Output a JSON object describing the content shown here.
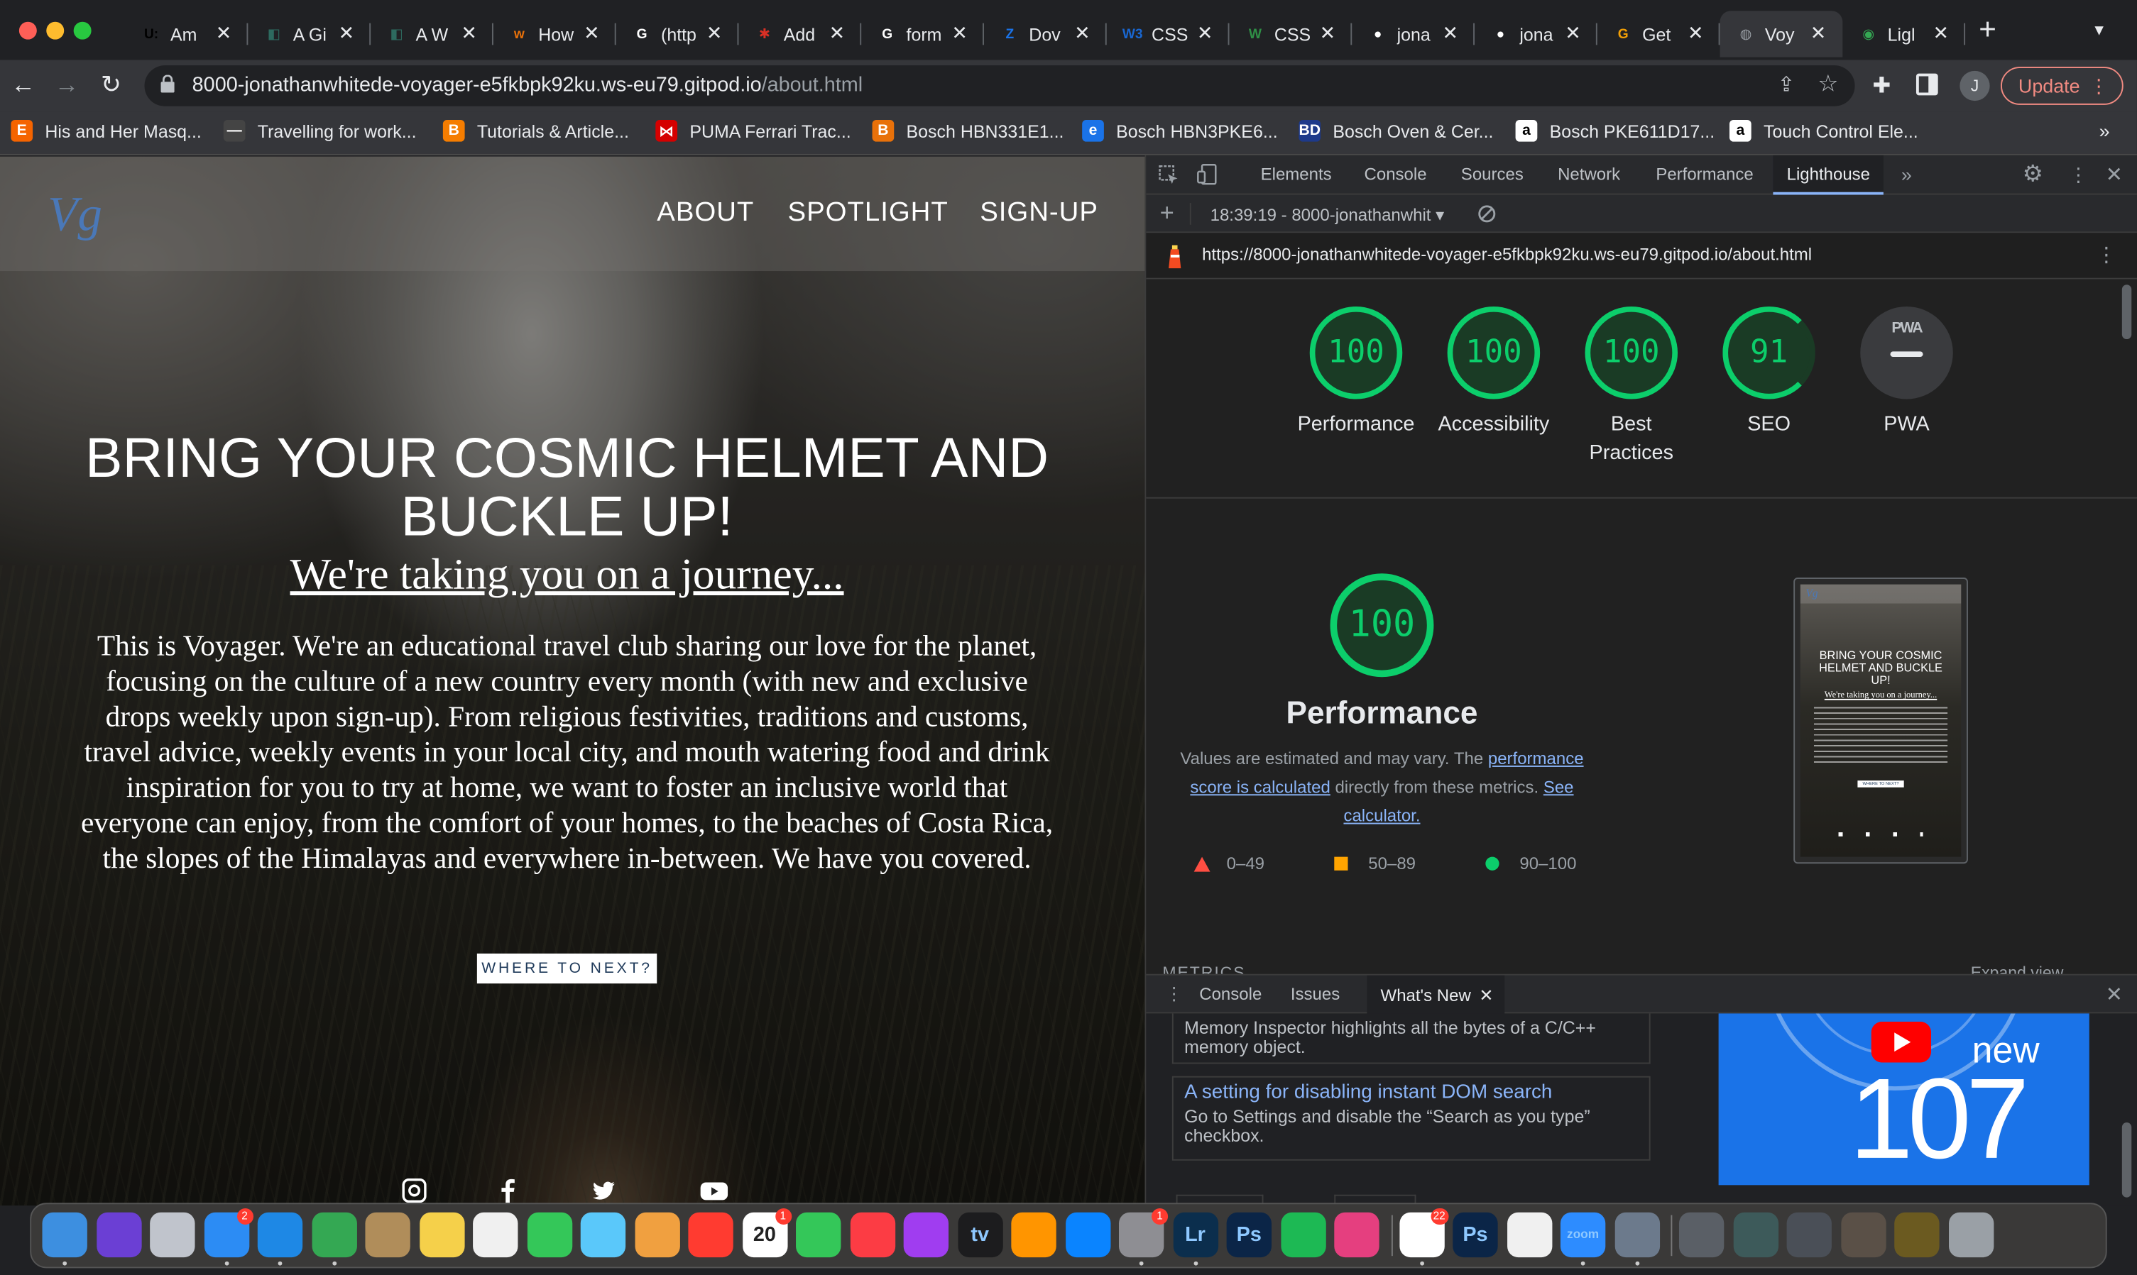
{
  "browser": {
    "tabs": [
      {
        "title": "Am",
        "icon": "upwork-icon",
        "favicon_color": "#000000",
        "favicon_text": "U:"
      },
      {
        "title": "A Gi",
        "icon": "gitpod-icon",
        "favicon_color": "#2d6a5f",
        "favicon_text": "◧"
      },
      {
        "title": "A W",
        "icon": "gitpod-icon",
        "favicon_color": "#2d6a5f",
        "favicon_text": "◧"
      },
      {
        "title": "How",
        "icon": "w3-icon",
        "favicon_color": "#e8710a",
        "favicon_text": "w"
      },
      {
        "title": "(http",
        "icon": "google-icon",
        "favicon_color": "#ffffff",
        "favicon_text": "G"
      },
      {
        "title": "Add",
        "icon": "asterisk-icon",
        "favicon_color": "#d93025",
        "favicon_text": "✱"
      },
      {
        "title": "form",
        "icon": "google-icon",
        "favicon_color": "#ffffff",
        "favicon_text": "G"
      },
      {
        "title": "Dov",
        "icon": "zoom-icon",
        "favicon_color": "#1a73e8",
        "favicon_text": "Z"
      },
      {
        "title": "CSS",
        "icon": "w3schools-icon",
        "favicon_color": "#1967d2",
        "favicon_text": "W3"
      },
      {
        "title": "CSS",
        "icon": "w3schools-green-icon",
        "favicon_color": "#2f8f46",
        "favicon_text": "W"
      },
      {
        "title": "jona",
        "icon": "github-icon",
        "favicon_color": "#ffffff",
        "favicon_text": "●"
      },
      {
        "title": "jona",
        "icon": "github-icon",
        "favicon_color": "#ffffff",
        "favicon_text": "●"
      },
      {
        "title": "Get",
        "icon": "gitpod-orange-icon",
        "favicon_color": "#f29f05",
        "favicon_text": "G"
      },
      {
        "title": "Voy",
        "icon": "globe-icon",
        "favicon_color": "#9aa0a6",
        "favicon_text": "◍",
        "active": true
      },
      {
        "title": "Ligl",
        "icon": "chrome-icon",
        "favicon_color": "#34a853",
        "favicon_text": "◉"
      }
    ],
    "address": {
      "host": "8000-jonathanwhitede-voyager-e5fkbpk92ku.ws-eu79.gitpod.io",
      "path": "/about.html"
    },
    "update_label": "Update",
    "profile_initial": "J",
    "bookmarks": [
      {
        "label": "His and Her Masq...",
        "icon": "etsy-icon",
        "color": "#f56400",
        "glyph": "E"
      },
      {
        "label": "Travelling for work...",
        "icon": "bookmark-icon",
        "color": "#444444",
        "glyph": "—"
      },
      {
        "label": "Tutorials & Article...",
        "icon": "blogger-icon",
        "color": "#f57d00",
        "glyph": "B"
      },
      {
        "label": "PUMA Ferrari Trac...",
        "icon": "puma-icon",
        "color": "#d50000",
        "glyph": "⋈"
      },
      {
        "label": "Bosch HBN331E1...",
        "icon": "ao-icon",
        "color": "#e8710a",
        "glyph": "B"
      },
      {
        "label": "Bosch HBN3PKE6...",
        "icon": "edge-icon",
        "color": "#1a73e8",
        "glyph": "e"
      },
      {
        "label": "Bosch Oven & Cer...",
        "icon": "bd-icon",
        "color": "#1e3a8a",
        "glyph": "BD"
      },
      {
        "label": "Bosch PKE611D17...",
        "icon": "amazon-icon",
        "color": "#ffffff",
        "glyph": "a"
      },
      {
        "label": "Touch Control Ele...",
        "icon": "amazon-icon",
        "color": "#ffffff",
        "glyph": "a"
      }
    ],
    "bookmarks_more": "»"
  },
  "site": {
    "logo_text": "Vg",
    "nav": [
      "ABOUT",
      "SPOTLIGHT",
      "SIGN-UP"
    ],
    "hero_title": "BRING YOUR COSMIC HELMET AND BUCKLE UP!",
    "hero_subtitle": "We're taking you on a journey...",
    "hero_body": "This is Voyager. We're an educational travel club sharing our love for the planet, focusing on the culture of a new country every month (with new and exclusive drops weekly upon sign-up). From religious festivities, traditions and customs, travel advice, weekly events in your local city, and mouth watering food and drink inspiration for you to try at home, we want to foster an inclusive world that everyone can enjoy, from the comfort of your homes, to the beaches of Costa Rica, the slopes of the Himalayas and everywhere in-between. We have you covered.",
    "cta": "WHERE TO NEXT?",
    "social": [
      "instagram-icon",
      "facebook-icon",
      "twitter-icon",
      "youtube-icon"
    ]
  },
  "devtools": {
    "tabs": [
      "Elements",
      "Console",
      "Sources",
      "Network",
      "Performance",
      "Lighthouse"
    ],
    "active_tab": "Lighthouse",
    "report_selector": "18:39:19 - 8000-jonathanwhit",
    "report_url": "https://8000-jonathanwhitede-voyager-e5fkbpk92ku.ws-eu79.gitpod.io/about.html",
    "scores": [
      {
        "label": "Performance",
        "score": "100"
      },
      {
        "label": "Accessibility",
        "score": "100"
      },
      {
        "label": "Best Practices",
        "score": "100"
      },
      {
        "label": "SEO",
        "score": "91"
      },
      {
        "label": "PWA",
        "score": "PWA"
      }
    ],
    "performance": {
      "score": "100",
      "title": "Performance",
      "desc_prefix": "Values are estimated and may vary. The ",
      "link1": "performance score is calculated",
      "desc_mid": " directly from these metrics. ",
      "link2": "See calculator.",
      "legend": [
        {
          "range": "0–49",
          "color": "#ff4e42",
          "shape": "triangle"
        },
        {
          "range": "50–89",
          "color": "#ffa400",
          "shape": "square"
        },
        {
          "range": "90–100",
          "color": "#0cce6b",
          "shape": "circle"
        }
      ]
    },
    "thumbnail": {
      "title": "BRING YOUR COSMIC HELMET AND BUCKLE UP!",
      "subtitle": "We're taking you on a journey...",
      "cta": "WHERE TO NEXT?"
    },
    "metrics_label": "METRICS",
    "expand_label": "Expand view",
    "drawer_tabs": [
      "Console",
      "Issues",
      "What's New"
    ],
    "whats_new": [
      {
        "title": "",
        "body": "Memory Inspector highlights all the bytes of a C/C++ memory object."
      },
      {
        "title": "A setting for disabling instant DOM search",
        "body": "Go to Settings and disable the “Search as you type” checkbox."
      }
    ],
    "promo": {
      "word": "new",
      "number": "107"
    }
  },
  "dock": {
    "items": [
      {
        "name": "finder-icon",
        "color": "#3d8fe0"
      },
      {
        "name": "siri-icon",
        "color": "#6b3fd4"
      },
      {
        "name": "launchpad-icon",
        "color": "#c0c4cc"
      },
      {
        "name": "mail-icon",
        "color": "#2c8cf4",
        "badge": "2"
      },
      {
        "name": "safari-icon",
        "color": "#1e88e5"
      },
      {
        "name": "chrome-icon",
        "color": "#34a853"
      },
      {
        "name": "contacts-icon",
        "color": "#b08d5a"
      },
      {
        "name": "notes-icon",
        "color": "#f5d04a"
      },
      {
        "name": "reminders-icon",
        "color": "#f0f0f0"
      },
      {
        "name": "messages-icon",
        "color": "#34c759"
      },
      {
        "name": "maps-icon",
        "color": "#5ac8fa"
      },
      {
        "name": "photos-icon",
        "color": "#f0a040"
      },
      {
        "name": "news-icon",
        "color": "#ff3b30"
      },
      {
        "name": "calendar-icon",
        "color": "#ffffff",
        "badge": "1",
        "label": "20"
      },
      {
        "name": "facetime-icon",
        "color": "#34c759"
      },
      {
        "name": "music-icon",
        "color": "#fc3c44"
      },
      {
        "name": "podcasts-icon",
        "color": "#a03df0"
      },
      {
        "name": "tv-icon",
        "color": "#1c1c1e",
        "label": "tv"
      },
      {
        "name": "books-icon",
        "color": "#ff9500"
      },
      {
        "name": "appstore-icon",
        "color": "#0a84ff"
      },
      {
        "name": "settings-icon",
        "color": "#8e8e93",
        "badge": "1"
      },
      {
        "name": "lightroom-icon",
        "color": "#0b2e4d",
        "label": "Lr"
      },
      {
        "name": "photoshop-icon",
        "color": "#0b2547",
        "label": "Ps"
      },
      {
        "name": "spotify-icon",
        "color": "#1db954"
      },
      {
        "name": "creative-cloud-icon",
        "color": "#e53f7f"
      },
      {
        "name": "slack-icon",
        "color": "#ffffff",
        "badge": "22"
      },
      {
        "name": "photoshop-icon",
        "color": "#0b2547",
        "label": "Ps"
      },
      {
        "name": "face-icon",
        "color": "#f0f0f0"
      },
      {
        "name": "zoom-icon",
        "color": "#2d8cff",
        "label": "zoom"
      },
      {
        "name": "preview-icon",
        "color": "#6c7a8c"
      },
      {
        "name": "window-thumb-icon",
        "color": "#5a5f66"
      },
      {
        "name": "window-thumb-icon",
        "color": "#3d5a5a"
      },
      {
        "name": "window-thumb-icon",
        "color": "#4a4f57"
      },
      {
        "name": "window-thumb-icon",
        "color": "#5a5047"
      },
      {
        "name": "window-thumb-icon",
        "color": "#6b5a20"
      },
      {
        "name": "trash-icon",
        "color": "#9aa0a6"
      }
    ]
  }
}
